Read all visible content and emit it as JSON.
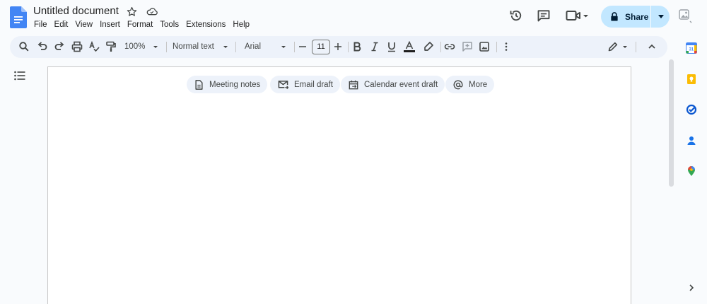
{
  "app": {
    "doc_title": "Untitled document",
    "menu": [
      "File",
      "Edit",
      "View",
      "Insert",
      "Format",
      "Tools",
      "Extensions",
      "Help"
    ],
    "share_label": "Share",
    "accent_color": "#0b57d0",
    "share_bg": "#c2e7ff"
  },
  "toolbar": {
    "zoom": "100%",
    "style": "Normal text",
    "font": "Arial",
    "font_size": "11",
    "icons": [
      "search-icon",
      "undo-icon",
      "redo-icon",
      "print-icon",
      "spellcheck-icon",
      "paint-format-icon",
      "bold-icon",
      "italic-icon",
      "underline-icon",
      "text-color-icon",
      "highlight-icon",
      "link-icon",
      "comment-icon",
      "image-icon",
      "more-icon",
      "editing-mode-icon",
      "collapse-icon"
    ]
  },
  "chips": [
    {
      "label": "Meeting notes",
      "icon": "document-icon"
    },
    {
      "label": "Email draft",
      "icon": "email-icon"
    },
    {
      "label": "Calendar event draft",
      "icon": "calendar-icon"
    },
    {
      "label": "More",
      "icon": "at-icon"
    }
  ],
  "side_panel": [
    "calendar-app-icon",
    "keep-icon",
    "tasks-icon",
    "contacts-icon",
    "maps-icon"
  ]
}
